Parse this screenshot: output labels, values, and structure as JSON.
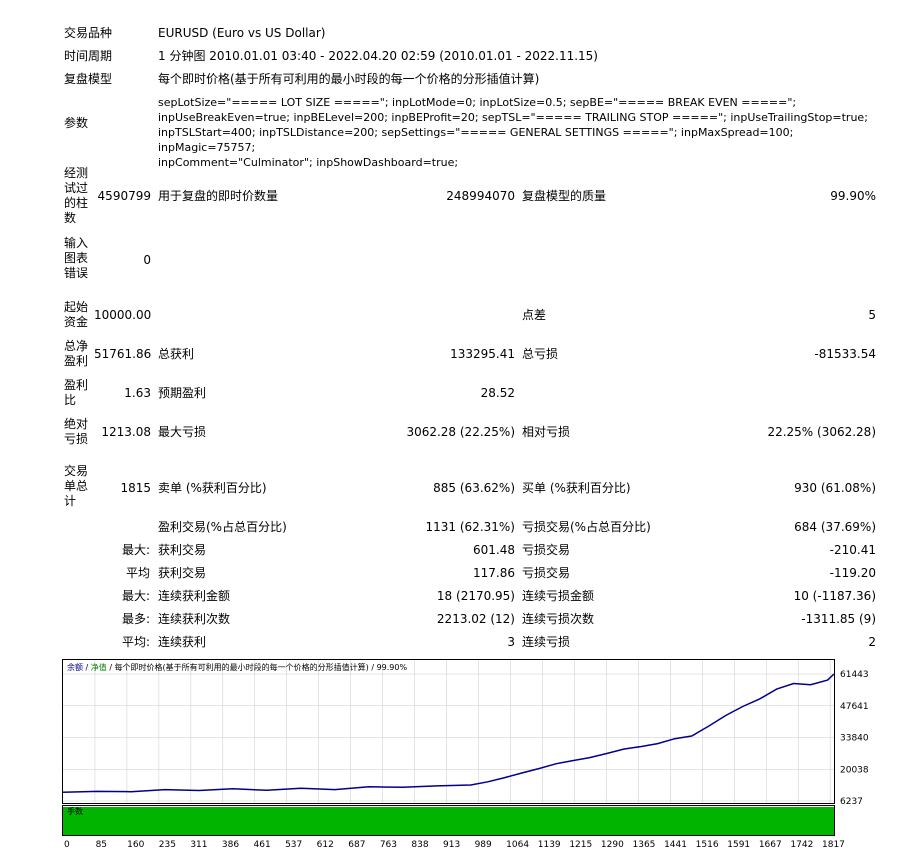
{
  "header": {
    "symbol_label": "交易品种",
    "symbol_value": "EURUSD (Euro vs US Dollar)",
    "period_label": "时间周期",
    "period_value": "1 分钟图 2010.01.01 03:40 - 2022.04.20 02:59 (2010.01.01 - 2022.11.15)",
    "model_label": "复盘模型",
    "model_value": "每个即时价格(基于所有可利用的最小时段的每一个价格的分形插值计算)",
    "params_label": "参数",
    "params_value": "sepLotSize=\"===== LOT SIZE =====\"; inpLotMode=0; inpLotSize=0.5; sepBE=\"===== BREAK EVEN =====\";\ninpUseBreakEven=true; inpBELevel=200; inpBEProfit=20; sepTSL=\"===== TRAILING STOP =====\"; inpUseTrailingStop=true;\ninpTSLStart=400; inpTSLDistance=200; sepSettings=\"===== GENERAL SETTINGS =====\"; inpMaxSpread=100; inpMagic=75757;\ninpComment=\"Culminator\"; inpShowDashboard=true;"
  },
  "stats": {
    "bars_label": "经测\n试过\n的柱\n数",
    "bars_value": "4590799",
    "ticks_label": "用于复盘的即时价数量",
    "ticks_value": "248994070",
    "quality_label": "复盘模型的质量",
    "quality_value": "99.90%",
    "errors_label": "输入\n图表\n错误",
    "errors_value": "0",
    "deposit_label": "起始\n资金",
    "deposit_value": "10000.00",
    "spread_label": "点差",
    "spread_value": "5",
    "net_label": "总净\n盈利",
    "net_value": "51761.86",
    "gross_profit_label": "总获利",
    "gross_profit_value": "133295.41",
    "gross_loss_label": "总亏损",
    "gross_loss_value": "-81533.54",
    "pf_label": "盈利\n比",
    "pf_value": "1.63",
    "expected_label": "预期盈利",
    "expected_value": "28.52",
    "abs_dd_label": "绝对\n亏损",
    "abs_dd_value": "1213.08",
    "max_dd_label": "最大亏损",
    "max_dd_value": "3062.28 (22.25%)",
    "rel_dd_label": "相对亏损",
    "rel_dd_value": "22.25% (3062.28)",
    "trades_label": "交易\n单总\n计",
    "trades_value": "1815",
    "short_label": "卖单 (%获利百分比)",
    "short_value": "885 (63.62%)",
    "long_label": "买单 (%获利百分比)",
    "long_value": "930 (61.08%)",
    "win_label": "盈利交易(%占总百分比)",
    "win_value": "1131 (62.31%)",
    "loss_label": "亏损交易(%占总百分比)",
    "loss_value": "684 (37.69%)",
    "rows": [
      {
        "prefix": "最大:",
        "l1": "获利交易",
        "v1": "601.48",
        "l2": "亏损交易",
        "v2": "-210.41"
      },
      {
        "prefix": "平均",
        "l1": "获利交易",
        "v1": "117.86",
        "l2": "亏损交易",
        "v2": "-119.20"
      },
      {
        "prefix": "最大:",
        "l1": "连续获利金额",
        "v1": "18 (2170.95)",
        "l2": "连续亏损金额",
        "v2": "10 (-1187.36)"
      },
      {
        "prefix": "最多:",
        "l1": "连续获利次数",
        "v1": "2213.02 (12)",
        "l2": "连续亏损次数",
        "v2": "-1311.85 (9)"
      },
      {
        "prefix": "平均:",
        "l1": "连续获利",
        "v1": "3",
        "l2": "连续亏损",
        "v2": "2"
      }
    ]
  },
  "chart_data": {
    "type": "line",
    "legend": {
      "balance": "余额",
      "equity": "净值",
      "rest": " / 每个即时价格(基于所有可利用的最小时段的每一个价格的分形插值计算) / 99.90%"
    },
    "volume_label": "手数",
    "x_ticks": [
      "0",
      "85",
      "160",
      "235",
      "311",
      "386",
      "461",
      "537",
      "612",
      "687",
      "763",
      "838",
      "913",
      "989",
      "1064",
      "1139",
      "1215",
      "1290",
      "1365",
      "1441",
      "1516",
      "1591",
      "1667",
      "1742",
      "1817"
    ],
    "y_ticks": [
      "61443",
      "47641",
      "33840",
      "20038",
      "6237"
    ],
    "ylim": [
      6237,
      61443
    ],
    "xlim": [
      0,
      1815
    ],
    "series": [
      {
        "color": "#00008b",
        "x": [
          0,
          80,
          160,
          240,
          320,
          400,
          480,
          560,
          640,
          720,
          800,
          880,
          960,
          1000,
          1040,
          1080,
          1120,
          1160,
          1200,
          1240,
          1280,
          1320,
          1360,
          1400,
          1440,
          1480,
          1520,
          1560,
          1600,
          1640,
          1680,
          1720,
          1760,
          1800,
          1815
        ],
        "y": [
          10000,
          10400,
          10300,
          11200,
          10800,
          11600,
          10900,
          11800,
          11200,
          12400,
          12200,
          12800,
          13200,
          14600,
          16400,
          18400,
          20300,
          22400,
          23800,
          25100,
          26900,
          28800,
          29900,
          31200,
          33300,
          34500,
          38800,
          43400,
          47300,
          50600,
          54900,
          57300,
          56800,
          58800,
          61443
        ]
      }
    ],
    "grid": true
  }
}
